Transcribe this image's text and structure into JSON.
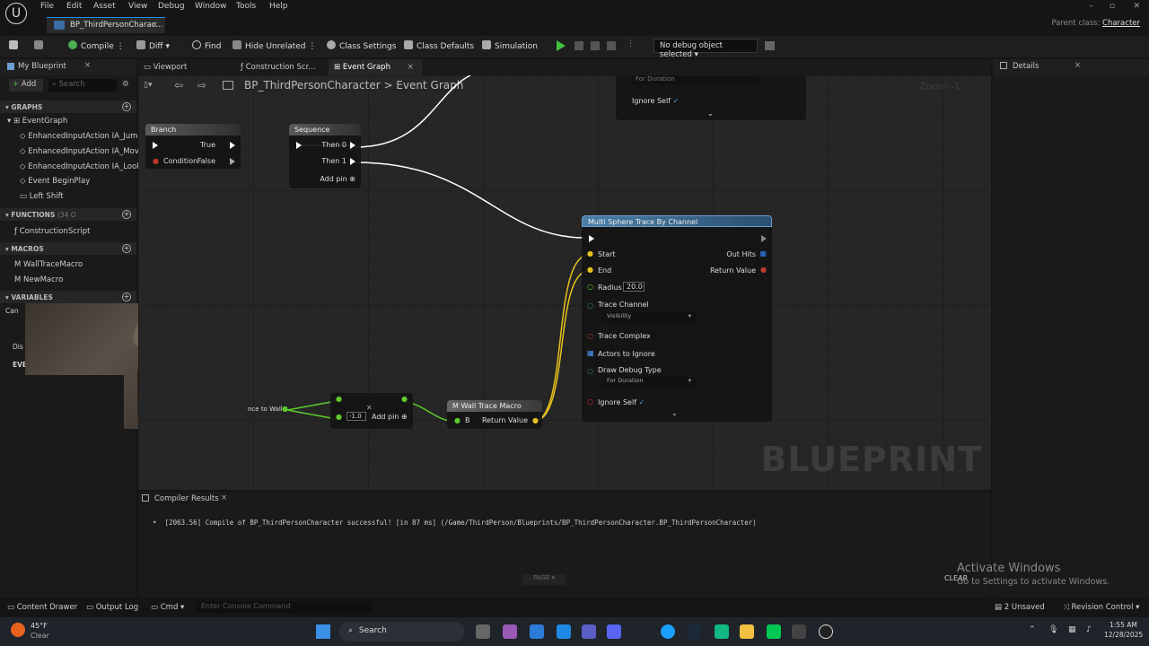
{
  "menu": [
    "File",
    "Edit",
    "Asset",
    "View",
    "Debug",
    "Window",
    "Tools",
    "Help"
  ],
  "document_tab": "BP_ThirdPersonCharac...",
  "parent_class": {
    "label": "Parent class:",
    "value": "Character"
  },
  "toolbar": {
    "compile": "Compile",
    "diff": "Diff",
    "find": "Find",
    "hide_unrelated": "Hide Unrelated",
    "class_settings": "Class Settings",
    "class_defaults": "Class Defaults",
    "simulation": "Simulation",
    "debug_object": "No debug object selected"
  },
  "left_panel": {
    "tab": "My Blueprint",
    "add": "Add",
    "search_placeholder": "Search",
    "graphs_title": "GRAPHS",
    "event_graph": "EventGraph",
    "graph_items": [
      "EnhancedInputAction IA_Jump",
      "EnhancedInputAction IA_Move",
      "EnhancedInputAction IA_Look",
      "Event BeginPlay",
      "Left Shift"
    ],
    "functions_title": "FUNCTIONS",
    "functions_count": "(34 O",
    "function_items": [
      "ConstructionScript"
    ],
    "macros_title": "MACROS",
    "macro_items": [
      "WallTraceMacro",
      "NewMacro"
    ],
    "variables_title": "VARIABLES",
    "partial": [
      "Can",
      "Dis",
      "EVE"
    ]
  },
  "editor_tabs": [
    "Viewport",
    "Construction Scr...",
    "Event Graph"
  ],
  "breadcrumb": {
    "root": "BP_ThirdPersonCharacter",
    "current": "Event Graph"
  },
  "zoom": "Zoom -1",
  "nodes": {
    "branch": {
      "title": "Branch",
      "true": "True",
      "condition": "Condition",
      "false": "False"
    },
    "sequence": {
      "title": "Sequence",
      "then0": "Then 0",
      "then1": "Then 1",
      "add_pin": "Add pin"
    },
    "top_partial": {
      "drop": "For Duration",
      "ignore_self": "Ignore Self"
    },
    "trace": {
      "title": "Multi Sphere Trace By Channel",
      "start": "Start",
      "end": "End",
      "out_hits": "Out Hits",
      "return_value": "Return Value",
      "radius_label": "Radius",
      "radius_value": "20.0",
      "trace_channel": "Trace Channel",
      "trace_channel_value": "Visibility",
      "trace_complex": "Trace Complex",
      "actors_to_ignore": "Actors to Ignore",
      "draw_debug_type": "Draw Debug Type",
      "draw_debug_value": "For Duration",
      "ignore_self": "Ignore Self"
    },
    "distance": {
      "label": "nce to Wall"
    },
    "add": {
      "value": "-1.0",
      "add_pin": "Add pin"
    },
    "wall_trace": {
      "title": "Wall Trace Macro",
      "b": "B",
      "return_value": "Return Value"
    }
  },
  "watermark": "BLUEPRINT",
  "details_tab": "Details",
  "compiler": {
    "tab": "Compiler Results",
    "message": "[2063.56] Compile of BP_ThirdPersonCharacter successful! [in 87 ms] (/Game/ThirdPerson/Blueprints/BP_ThirdPersonCharacter.BP_ThirdPersonCharacter)",
    "page": "PAGE",
    "clear": "CLEAR"
  },
  "activate": {
    "title": "Activate Windows",
    "sub": "Go to Settings to activate Windows."
  },
  "statusbar": {
    "content_drawer": "Content Drawer",
    "output_log": "Output Log",
    "cmd": "Cmd",
    "console_placeholder": "Enter Console Command",
    "unsaved": "2 Unsaved",
    "revision": "Revision Control"
  },
  "taskbar": {
    "temp": "45°F",
    "weather": "Clear",
    "search": "Search",
    "time": "1:55 AM",
    "date": "12/28/2025"
  }
}
